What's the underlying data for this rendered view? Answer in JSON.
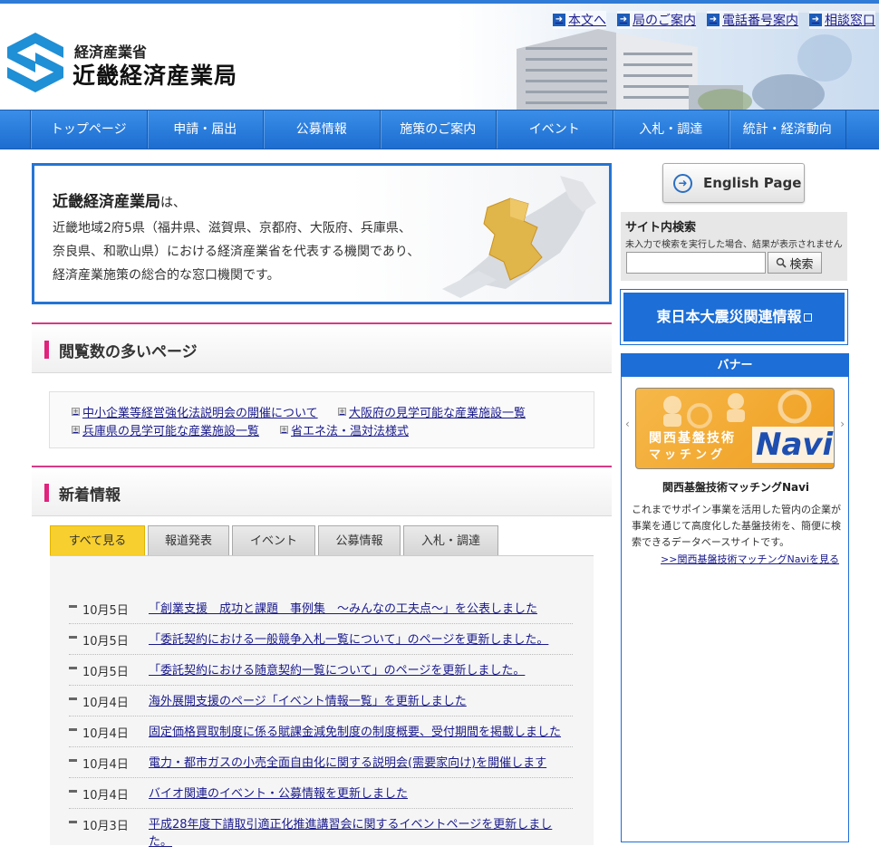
{
  "header": {
    "logo_sub": "経済産業省",
    "logo_main": "近畿経済産業局",
    "util_links": [
      {
        "label": "本文へ"
      },
      {
        "label": "局のご案内"
      },
      {
        "label": "電話番号案内"
      },
      {
        "label": "相談窓口"
      }
    ]
  },
  "nav": {
    "items": [
      {
        "label": "トップページ"
      },
      {
        "label": "申請・届出"
      },
      {
        "label": "公募情報"
      },
      {
        "label": "施策のご案内"
      },
      {
        "label": "イベント"
      },
      {
        "label": "入札・調達"
      },
      {
        "label": "統計・経済動向"
      }
    ]
  },
  "intro": {
    "title_bold": "近畿経済産業局",
    "title_suffix": "は、",
    "lines": [
      "近畿地域2府5県（福井県、滋賀県、京都府、大阪府、兵庫県、",
      "奈良県、和歌山県）における経済産業省を代表する機関であり、",
      "経済産業施策の総合的な窓口機関です。"
    ]
  },
  "popular": {
    "title": "閲覧数の多いページ",
    "links": [
      {
        "label": "中小企業等経営強化法説明会の開催について"
      },
      {
        "label": "大阪府の見学可能な産業施設一覧"
      },
      {
        "label": "兵庫県の見学可能な産業施設一覧"
      },
      {
        "label": "省エネ法・温対法様式"
      }
    ]
  },
  "news": {
    "title": "新着情報",
    "tabs": [
      {
        "label": "すべて見る"
      },
      {
        "label": "報道発表"
      },
      {
        "label": "イベント"
      },
      {
        "label": "公募情報"
      },
      {
        "label": "入札・調達"
      }
    ],
    "items": [
      {
        "date": "10月5日",
        "text": "「創業支援　成功と課題　事例集　～みんなの工夫点～」を公表しました"
      },
      {
        "date": "10月5日",
        "text": "「委託契約における一般競争入札一覧について」のページを更新しました。"
      },
      {
        "date": "10月5日",
        "text": "「委託契約における随意契約一覧について」のページを更新しました。"
      },
      {
        "date": "10月4日",
        "text": "海外展開支援のページ「イベント情報一覧」を更新しました"
      },
      {
        "date": "10月4日",
        "text": "固定価格買取制度に係る賦課金減免制度の制度概要、受付期間を掲載しました"
      },
      {
        "date": "10月4日",
        "text": "電力・都市ガスの小売全面自由化に関する説明会(需要家向け)を開催します"
      },
      {
        "date": "10月4日",
        "text": "バイオ関連のイベント・公募情報を更新しました"
      },
      {
        "date": "10月3日",
        "text": "平成28年度下請取引適正化推進講習会に関するイベントページを更新しました。"
      }
    ]
  },
  "sidebar": {
    "english_label": "English Page",
    "search": {
      "heading": "サイト内検索",
      "note": "未入力で検索を実行した場合、結果が表示されません",
      "button": "検索",
      "value": ""
    },
    "quake_label": "東日本大震災関連情報",
    "banner": {
      "heading": "バナー",
      "img_line1": "関西基盤技術",
      "img_line2": "マッチング",
      "img_navi": "Navi",
      "caption": "関西基盤技術マッチングNavi",
      "desc": "これまでサポイン事業を活用した管内の企業が事業を通じて高度化した基盤技術を、簡便に検索できるデータベースサイトです。",
      "more": ">>関西基盤技術マッチングNaviを見る"
    }
  },
  "colors": {
    "nav_blue": "#1d6dd0",
    "accent_pink": "#e0237c",
    "active_tab": "#f7cf2e"
  }
}
